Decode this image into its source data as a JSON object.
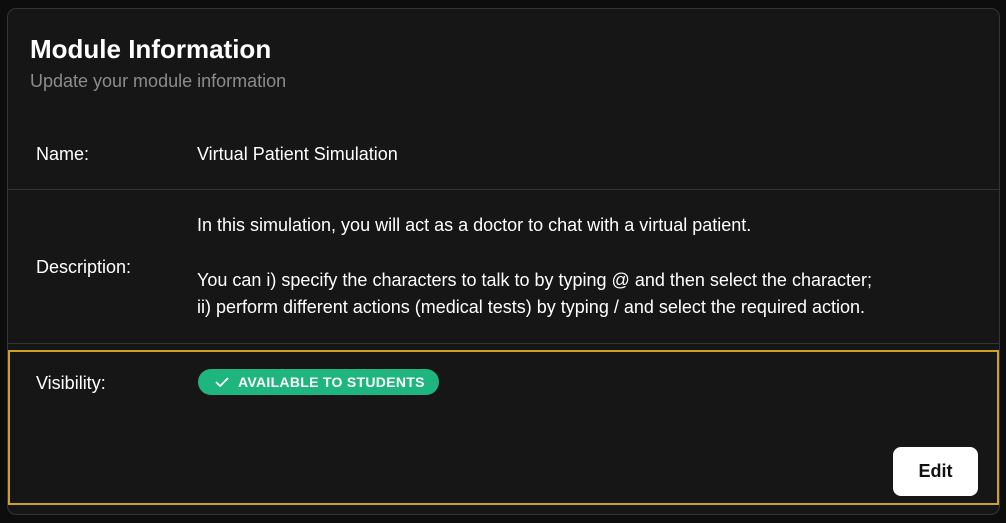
{
  "header": {
    "title": "Module Information",
    "subtitle": "Update your module information"
  },
  "fields": {
    "name": {
      "label": "Name:",
      "value": "Virtual Patient Simulation"
    },
    "description": {
      "label": "Description:",
      "lines": [
        "In this simulation, you will act as a doctor to chat with a virtual patient.",
        "You can i) specify the characters to talk to by typing @ and then select the character;",
        "ii)  perform different actions (medical tests) by typing / and select the required action."
      ]
    },
    "visibility": {
      "label": "Visibility:",
      "badge_text": "AVAILABLE TO STUDENTS",
      "badge_icon": "check-icon"
    }
  },
  "actions": {
    "edit_label": "Edit"
  },
  "colors": {
    "card_background": "#161616",
    "badge_green": "#1fb57f",
    "highlight_border": "#c9a227",
    "muted_text": "#8c8c8c"
  }
}
